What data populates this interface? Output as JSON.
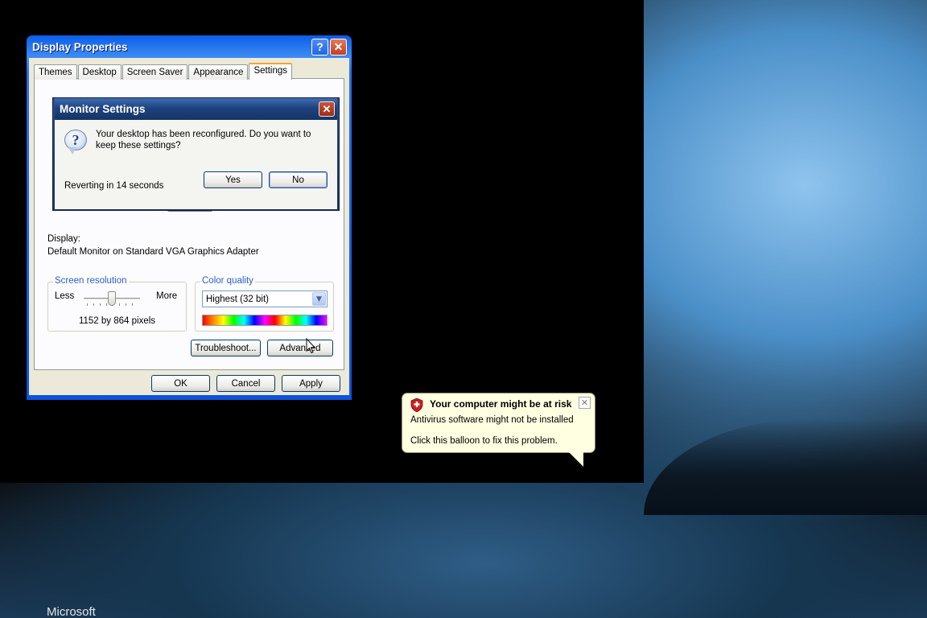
{
  "display_properties": {
    "title": "Display Properties",
    "help_glyph": "?",
    "close_glyph": "✕",
    "tabs": [
      {
        "label": "Themes",
        "active": false
      },
      {
        "label": "Desktop",
        "active": false
      },
      {
        "label": "Screen Saver",
        "active": false
      },
      {
        "label": "Appearance",
        "active": false
      },
      {
        "label": "Settings",
        "active": true
      }
    ],
    "display_label": "Display:",
    "display_value": "Default Monitor on Standard VGA Graphics Adapter",
    "screen_resolution": {
      "legend": "Screen resolution",
      "less": "Less",
      "more": "More",
      "value": "1152 by 864 pixels"
    },
    "color_quality": {
      "legend": "Color quality",
      "selected": "Highest (32 bit)"
    },
    "buttons": {
      "troubleshoot": "Troubleshoot...",
      "advanced": "Advanced",
      "ok": "OK",
      "cancel": "Cancel",
      "apply": "Apply"
    }
  },
  "monitor_settings": {
    "title": "Monitor Settings",
    "close_glyph": "✕",
    "message": "Your desktop has been reconfigured.  Do you want to keep these settings?",
    "reverting": "Reverting in 14 seconds",
    "yes": "Yes",
    "no": "No",
    "icon": "question-icon"
  },
  "balloon": {
    "title": "Your computer might be at risk",
    "line1": "Antivirus software might not be installed",
    "line2": "Click this balloon to fix this problem.",
    "close_glyph": "✕",
    "icon": "security-shield-icon"
  },
  "desktop": {
    "logo_text": "Microsoft"
  }
}
